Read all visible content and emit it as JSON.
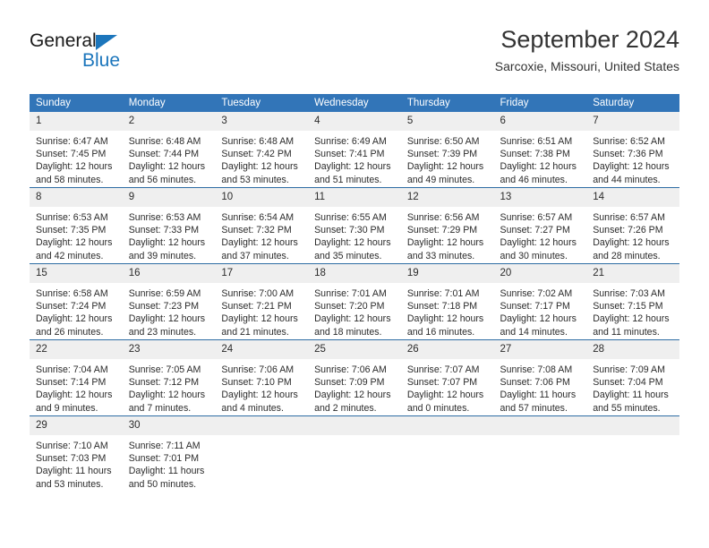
{
  "logo": {
    "word_top": "General",
    "word_bottom": "Blue",
    "accent_color": "#1c76bc"
  },
  "header": {
    "title": "September 2024",
    "subtitle": "Sarcoxie, Missouri, United States"
  },
  "calendar": {
    "header_bg": "#3275b8",
    "daynum_bg": "#efefef",
    "separator_color": "#2e6da4",
    "weekdays": [
      "Sunday",
      "Monday",
      "Tuesday",
      "Wednesday",
      "Thursday",
      "Friday",
      "Saturday"
    ],
    "weeks": [
      [
        {
          "day": "1",
          "sunrise": "Sunrise: 6:47 AM",
          "sunset": "Sunset: 7:45 PM",
          "daylight": "Daylight: 12 hours and 58 minutes."
        },
        {
          "day": "2",
          "sunrise": "Sunrise: 6:48 AM",
          "sunset": "Sunset: 7:44 PM",
          "daylight": "Daylight: 12 hours and 56 minutes."
        },
        {
          "day": "3",
          "sunrise": "Sunrise: 6:48 AM",
          "sunset": "Sunset: 7:42 PM",
          "daylight": "Daylight: 12 hours and 53 minutes."
        },
        {
          "day": "4",
          "sunrise": "Sunrise: 6:49 AM",
          "sunset": "Sunset: 7:41 PM",
          "daylight": "Daylight: 12 hours and 51 minutes."
        },
        {
          "day": "5",
          "sunrise": "Sunrise: 6:50 AM",
          "sunset": "Sunset: 7:39 PM",
          "daylight": "Daylight: 12 hours and 49 minutes."
        },
        {
          "day": "6",
          "sunrise": "Sunrise: 6:51 AM",
          "sunset": "Sunset: 7:38 PM",
          "daylight": "Daylight: 12 hours and 46 minutes."
        },
        {
          "day": "7",
          "sunrise": "Sunrise: 6:52 AM",
          "sunset": "Sunset: 7:36 PM",
          "daylight": "Daylight: 12 hours and 44 minutes."
        }
      ],
      [
        {
          "day": "8",
          "sunrise": "Sunrise: 6:53 AM",
          "sunset": "Sunset: 7:35 PM",
          "daylight": "Daylight: 12 hours and 42 minutes."
        },
        {
          "day": "9",
          "sunrise": "Sunrise: 6:53 AM",
          "sunset": "Sunset: 7:33 PM",
          "daylight": "Daylight: 12 hours and 39 minutes."
        },
        {
          "day": "10",
          "sunrise": "Sunrise: 6:54 AM",
          "sunset": "Sunset: 7:32 PM",
          "daylight": "Daylight: 12 hours and 37 minutes."
        },
        {
          "day": "11",
          "sunrise": "Sunrise: 6:55 AM",
          "sunset": "Sunset: 7:30 PM",
          "daylight": "Daylight: 12 hours and 35 minutes."
        },
        {
          "day": "12",
          "sunrise": "Sunrise: 6:56 AM",
          "sunset": "Sunset: 7:29 PM",
          "daylight": "Daylight: 12 hours and 33 minutes."
        },
        {
          "day": "13",
          "sunrise": "Sunrise: 6:57 AM",
          "sunset": "Sunset: 7:27 PM",
          "daylight": "Daylight: 12 hours and 30 minutes."
        },
        {
          "day": "14",
          "sunrise": "Sunrise: 6:57 AM",
          "sunset": "Sunset: 7:26 PM",
          "daylight": "Daylight: 12 hours and 28 minutes."
        }
      ],
      [
        {
          "day": "15",
          "sunrise": "Sunrise: 6:58 AM",
          "sunset": "Sunset: 7:24 PM",
          "daylight": "Daylight: 12 hours and 26 minutes."
        },
        {
          "day": "16",
          "sunrise": "Sunrise: 6:59 AM",
          "sunset": "Sunset: 7:23 PM",
          "daylight": "Daylight: 12 hours and 23 minutes."
        },
        {
          "day": "17",
          "sunrise": "Sunrise: 7:00 AM",
          "sunset": "Sunset: 7:21 PM",
          "daylight": "Daylight: 12 hours and 21 minutes."
        },
        {
          "day": "18",
          "sunrise": "Sunrise: 7:01 AM",
          "sunset": "Sunset: 7:20 PM",
          "daylight": "Daylight: 12 hours and 18 minutes."
        },
        {
          "day": "19",
          "sunrise": "Sunrise: 7:01 AM",
          "sunset": "Sunset: 7:18 PM",
          "daylight": "Daylight: 12 hours and 16 minutes."
        },
        {
          "day": "20",
          "sunrise": "Sunrise: 7:02 AM",
          "sunset": "Sunset: 7:17 PM",
          "daylight": "Daylight: 12 hours and 14 minutes."
        },
        {
          "day": "21",
          "sunrise": "Sunrise: 7:03 AM",
          "sunset": "Sunset: 7:15 PM",
          "daylight": "Daylight: 12 hours and 11 minutes."
        }
      ],
      [
        {
          "day": "22",
          "sunrise": "Sunrise: 7:04 AM",
          "sunset": "Sunset: 7:14 PM",
          "daylight": "Daylight: 12 hours and 9 minutes."
        },
        {
          "day": "23",
          "sunrise": "Sunrise: 7:05 AM",
          "sunset": "Sunset: 7:12 PM",
          "daylight": "Daylight: 12 hours and 7 minutes."
        },
        {
          "day": "24",
          "sunrise": "Sunrise: 7:06 AM",
          "sunset": "Sunset: 7:10 PM",
          "daylight": "Daylight: 12 hours and 4 minutes."
        },
        {
          "day": "25",
          "sunrise": "Sunrise: 7:06 AM",
          "sunset": "Sunset: 7:09 PM",
          "daylight": "Daylight: 12 hours and 2 minutes."
        },
        {
          "day": "26",
          "sunrise": "Sunrise: 7:07 AM",
          "sunset": "Sunset: 7:07 PM",
          "daylight": "Daylight: 12 hours and 0 minutes."
        },
        {
          "day": "27",
          "sunrise": "Sunrise: 7:08 AM",
          "sunset": "Sunset: 7:06 PM",
          "daylight": "Daylight: 11 hours and 57 minutes."
        },
        {
          "day": "28",
          "sunrise": "Sunrise: 7:09 AM",
          "sunset": "Sunset: 7:04 PM",
          "daylight": "Daylight: 11 hours and 55 minutes."
        }
      ],
      [
        {
          "day": "29",
          "sunrise": "Sunrise: 7:10 AM",
          "sunset": "Sunset: 7:03 PM",
          "daylight": "Daylight: 11 hours and 53 minutes."
        },
        {
          "day": "30",
          "sunrise": "Sunrise: 7:11 AM",
          "sunset": "Sunset: 7:01 PM",
          "daylight": "Daylight: 11 hours and 50 minutes."
        },
        {
          "day": "",
          "sunrise": "",
          "sunset": "",
          "daylight": ""
        },
        {
          "day": "",
          "sunrise": "",
          "sunset": "",
          "daylight": ""
        },
        {
          "day": "",
          "sunrise": "",
          "sunset": "",
          "daylight": ""
        },
        {
          "day": "",
          "sunrise": "",
          "sunset": "",
          "daylight": ""
        },
        {
          "day": "",
          "sunrise": "",
          "sunset": "",
          "daylight": ""
        }
      ]
    ]
  }
}
